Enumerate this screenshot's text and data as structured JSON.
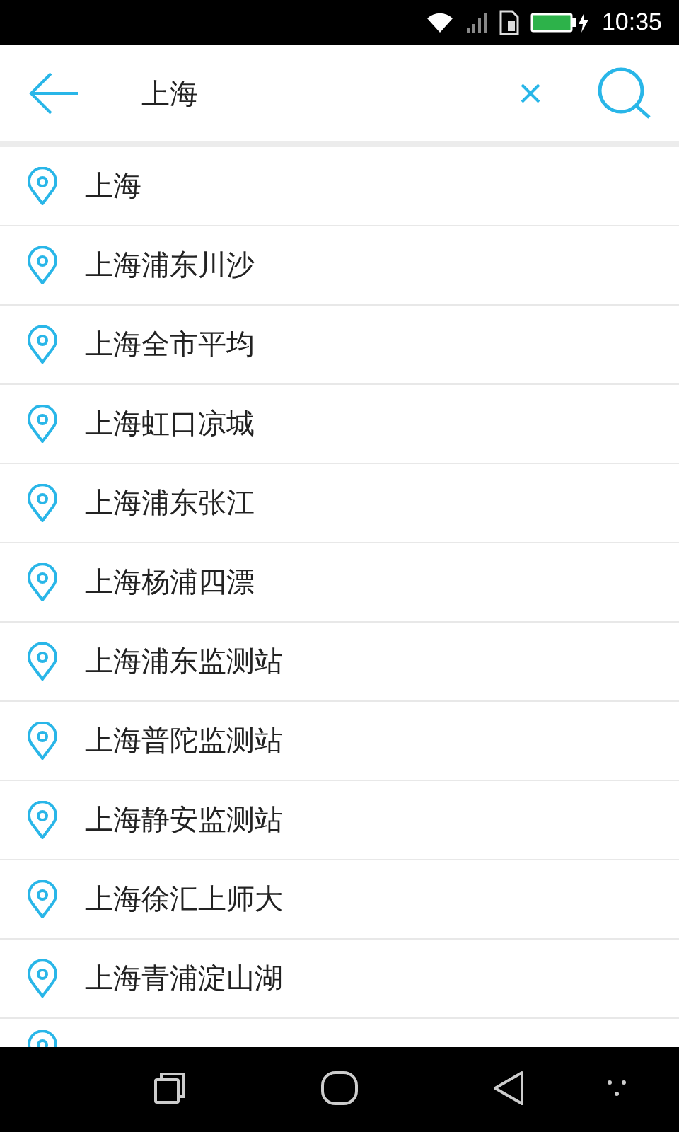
{
  "status_bar": {
    "time": "10:35"
  },
  "search": {
    "value": "上海"
  },
  "results": [
    {
      "name": "上海"
    },
    {
      "name": "上海浦东川沙"
    },
    {
      "name": "上海全市平均"
    },
    {
      "name": "上海虹口凉城"
    },
    {
      "name": "上海浦东张江"
    },
    {
      "name": "上海杨浦四漂"
    },
    {
      "name": "上海浦东监测站"
    },
    {
      "name": "上海普陀监测站"
    },
    {
      "name": "上海静安监测站"
    },
    {
      "name": "上海徐汇上师大"
    },
    {
      "name": "上海青浦淀山湖"
    }
  ]
}
